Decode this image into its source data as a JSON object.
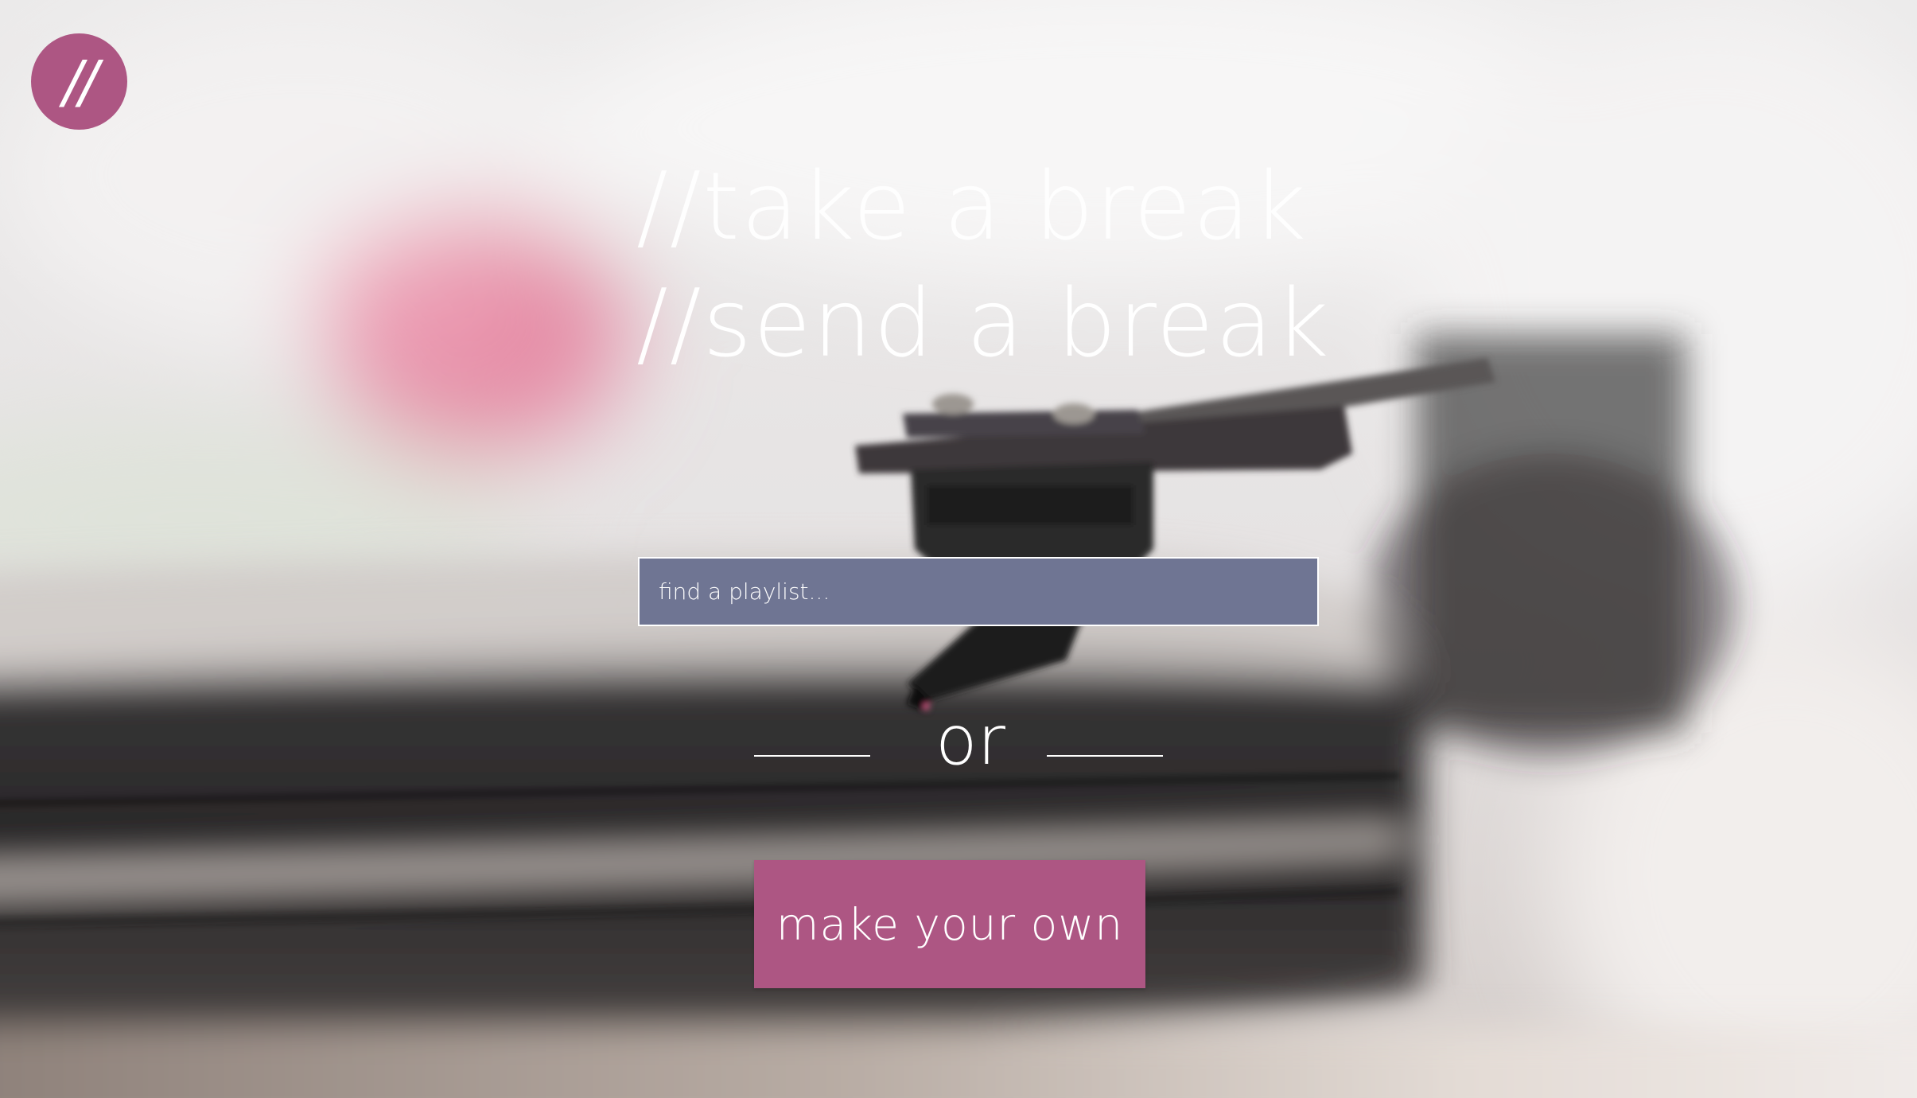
{
  "logo": {
    "text": "//",
    "color": "#ad5683"
  },
  "hero": {
    "line1": "//take a break",
    "line2": "//send a break"
  },
  "search": {
    "placeholder": "find a playlist...",
    "value": "",
    "background": "#6f7593"
  },
  "divider": {
    "text": "or"
  },
  "cta": {
    "label": "make your own",
    "color": "#ad5683"
  },
  "background": {
    "subject": "turntable-record-photo"
  }
}
